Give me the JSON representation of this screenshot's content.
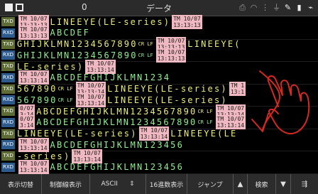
{
  "status_bar": {
    "counter": "0",
    "title": "データ"
  },
  "labels": {
    "txd": "TXD",
    "rxd": "RXD"
  },
  "rows": [
    {
      "tx": [
        [
          "ts",
          "TM 10/07",
          "13:13:13"
        ],
        [
          "tx",
          "LINEEYE(LE-series)"
        ],
        [
          "ts",
          "TM 10/07",
          "13:13:13"
        ]
      ],
      "rx": [
        [
          "ts",
          "TM 10/07",
          "13:13:13"
        ],
        [
          "rx",
          "ABCDEF"
        ]
      ]
    },
    {
      "tx": [
        [
          "tx",
          "GHIJKLMN1234567890"
        ],
        [
          "cl",
          "CR LF"
        ],
        [
          "ts",
          "TM 10/07",
          "13:13:13"
        ],
        [
          "tx",
          "LINEEYE("
        ]
      ],
      "rx": [
        [
          "rx",
          "GHIJKLMN1234567890"
        ],
        [
          "cl",
          "CR LF"
        ],
        [
          "ts",
          "TM 10/07",
          "13:13:13"
        ]
      ]
    },
    {
      "tx": [
        [
          "tx",
          "LE-series)"
        ],
        [
          "ts",
          "TM 10/07",
          "13:13:14"
        ]
      ],
      "rx": [
        [
          "ts",
          "TM 10/07",
          "13:13:14"
        ],
        [
          "rx",
          "ABCDEFGHIJKLMN1234"
        ]
      ]
    },
    {
      "tx": [
        [
          "tx",
          "567890"
        ],
        [
          "cl",
          "CR LF"
        ],
        [
          "ts",
          "TM 10/07",
          "13:13:14"
        ],
        [
          "tx",
          "LINEEYE(LE-series)"
        ],
        [
          "ts",
          "TM 1",
          "13:1"
        ]
      ],
      "rx": [
        [
          "rx",
          "567890"
        ],
        [
          "cl",
          "CR LF"
        ],
        [
          "ts",
          "TM 10/07",
          "13:13:14"
        ],
        [
          "tx",
          "LINEEYE(LE-series)"
        ]
      ]
    },
    {
      "tx": [
        [
          "ts",
          "0/07",
          "3:14"
        ],
        [
          "tx",
          "ABCDEFGHIJKLMN1234567890"
        ],
        [
          "cl",
          "CR LF"
        ],
        [
          "ts",
          "TM 10/07",
          "13:13:14"
        ]
      ],
      "rx": [
        [
          "ts",
          "0/07",
          "3:14"
        ],
        [
          "rx",
          "ABCDEFGHIJKLMN1234567890"
        ],
        [
          "cl",
          "CR LF"
        ],
        [
          "ts",
          "TM 10/07",
          "13:13:14"
        ]
      ]
    },
    {
      "tx": [
        [
          "tx",
          "LINEEYE(LE-series)"
        ],
        [
          "ts",
          "TM 10/07",
          "13:13:14"
        ],
        [
          "tx",
          "LINEEYE(LE"
        ]
      ],
      "rx": [
        [
          "ts",
          "TM 10/07",
          "13:13:14"
        ],
        [
          "rx",
          "ABCDEFGHIJKLMN123456"
        ]
      ]
    },
    {
      "tx": [
        [
          "tx",
          "-series)"
        ],
        [
          "ts",
          "TM 10/07",
          "13:13:14"
        ]
      ],
      "rx": [
        [
          "ts",
          "TM 10/07",
          "13:13:14"
        ],
        [
          "rx",
          "ABCDEFGHIJKLMN123456"
        ]
      ]
    }
  ],
  "toolbar": {
    "display_switch": "表示切替",
    "control_lines": "制御線表示",
    "encoding": "ASCII",
    "hex_display": "16進数表示",
    "jump": "ジャンプ",
    "up": "▲",
    "search": "検索",
    "down": "▼",
    "menu": "⇶"
  },
  "colors": {
    "tx_text": "#ecec78",
    "rx_text": "#8ff08f",
    "timestamp_bg": "#f0b8c0",
    "txd_label_bg": "#5e6b34",
    "rxd_label_bg": "#2e5b8e",
    "annotation": "#d42a20"
  }
}
